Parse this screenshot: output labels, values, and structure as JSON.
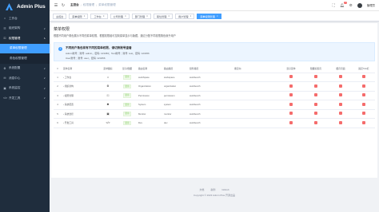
{
  "app": {
    "name": "Admin Plus"
  },
  "sidebar": {
    "items": [
      {
        "label": "工作台",
        "icon": "home-icon"
      },
      {
        "label": "组织架构",
        "icon": "org-icon",
        "arrow": "∨"
      },
      {
        "label": "权限管理",
        "icon": "lock-icon",
        "arrow": "∧",
        "open": true
      },
      {
        "label": "系统配置",
        "icon": "settings-icon",
        "arrow": "∨"
      },
      {
        "label": "消息中心",
        "icon": "message-icon",
        "arrow": "∨"
      },
      {
        "label": "系统监控",
        "icon": "monitor-icon",
        "arrow": "∨"
      },
      {
        "label": "开发工具",
        "icon": "code-icon",
        "arrow": "∨"
      }
    ],
    "submenu": [
      {
        "label": "菜单权限管理",
        "active": true
      },
      {
        "label": "角色权限管理"
      }
    ]
  },
  "navbar": {
    "breadcrumb": [
      "主控台",
      "权限管理",
      "菜单权限管理"
    ],
    "badge": "3",
    "username": "管理员"
  },
  "tags": [
    {
      "label": "主控台"
    },
    {
      "label": "菜单权限"
    },
    {
      "label": "工作台"
    },
    {
      "label": "公司管理"
    },
    {
      "label": "部门管理"
    },
    {
      "label": "职位管理"
    },
    {
      "label": "用户管理"
    },
    {
      "label": "菜单权限管理",
      "active": true
    }
  ],
  "page": {
    "title": "菜单权限",
    "desc": "根据不同用户角色展示不同的菜单权限，根据权限组可控制菜单显示与隐藏，通过分配不同权限角色赋予用户",
    "notice_title": "不同用户角色将有不同的菜单权限，请切换账号查看",
    "notice_line1": "Admin账号：账号: admin，密码: 123456；Test账号：账号: test，密码: 123456",
    "notice_line2": "User账号：账号: user，密码: 123456"
  },
  "table": {
    "columns": [
      "#",
      "菜单名称",
      "菜单图标",
      "显示/隐藏",
      "路由名称",
      "路由路径",
      "组件路径",
      "重定向",
      "显示菜单",
      "隐藏标签页",
      "缓存页面",
      "固定Tab栏"
    ],
    "rows": [
      {
        "idx": "1",
        "name": "工作台",
        "icon": "⌂",
        "show": "显示",
        "route": "workSpace",
        "path": "workspace",
        "comp": "workbench"
      },
      {
        "idx": "2",
        "name": "组织架构",
        "icon": "⚙",
        "show": "显示",
        "route": "Organization",
        "path": "organization",
        "comp": "workbench"
      },
      {
        "idx": "3",
        "name": "权限管理",
        "icon": "⚿",
        "show": "显示",
        "route": "Permission",
        "path": "permission",
        "comp": "workbench"
      },
      {
        "idx": "4",
        "name": "系统配置",
        "icon": "✱",
        "show": "显示",
        "route": "System",
        "path": "system",
        "comp": "workbench"
      },
      {
        "idx": "5",
        "name": "系统监控",
        "icon": "▣",
        "show": "显示",
        "route": "Monitor",
        "path": "monitor",
        "comp": "workbench"
      },
      {
        "idx": "6",
        "name": "开发工具",
        "icon": "</>",
        "show": "显示",
        "route": "Dev",
        "path": "dev",
        "comp": "workbench"
      }
    ]
  },
  "footer": {
    "links": [
      "文档",
      "案例",
      "GitHub"
    ],
    "copyright": "Copyright © 2023 Admin Plus 开源出品"
  },
  "colors": {
    "primary": "#409eff",
    "sidebar": "#1f2d3d",
    "success": "#67c23a",
    "danger": "#f56c6c"
  }
}
